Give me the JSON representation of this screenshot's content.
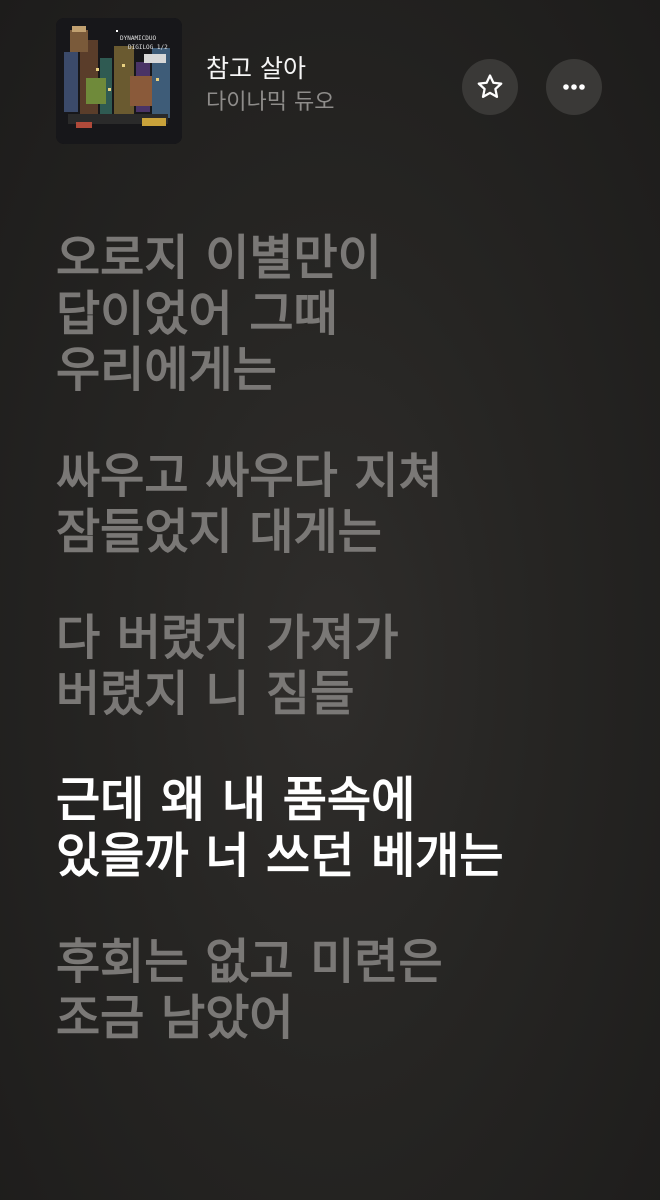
{
  "track": {
    "title": "참고 살아",
    "artist": "다이나믹 듀오",
    "album_art_text": [
      "DYNAMICDUO",
      "DIGILOG 1/2"
    ]
  },
  "actions": {
    "favorite_icon": "star-outline-icon",
    "more_icon": "ellipsis-icon"
  },
  "lyrics": {
    "active_stanza": 3,
    "stanzas": [
      {
        "lines": [
          "오로지 이별만이",
          "답이었어 그때",
          "우리에게는"
        ]
      },
      {
        "lines": [
          "싸우고 싸우다 지쳐",
          "잠들었지 대게는"
        ]
      },
      {
        "lines": [
          "다 버렸지 가져가",
          "버렸지 니 짐들"
        ]
      },
      {
        "lines": [
          "근데 왜 내 품속에",
          "있을까 너 쓰던 베개는"
        ]
      },
      {
        "lines": [
          "후회는 없고 미련은",
          "조금 남았어"
        ]
      }
    ]
  },
  "colors": {
    "background": "#262523",
    "inactive_lyric": "#7a7876",
    "active_lyric": "#ffffff",
    "button_bg": "#3a3937"
  }
}
